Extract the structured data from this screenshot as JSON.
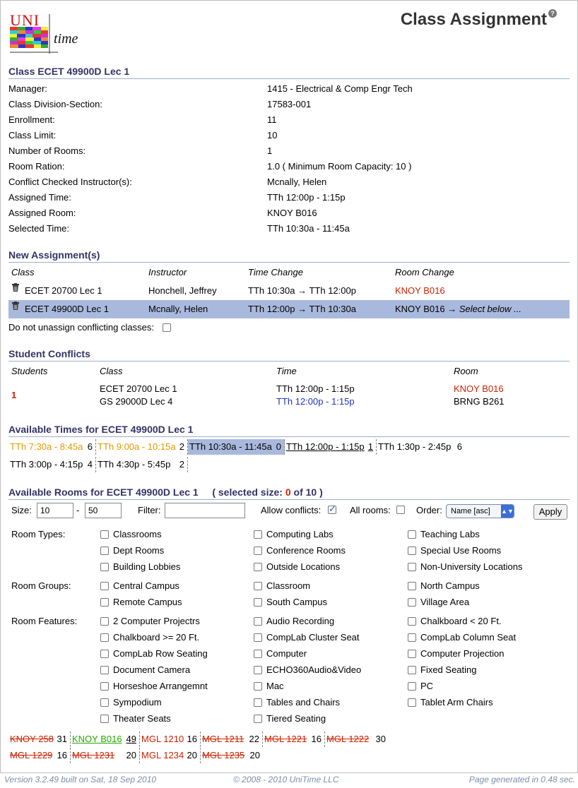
{
  "app": {
    "logo_text_1": "UNI",
    "logo_text_2": "time"
  },
  "page_title": "Class Assignment",
  "class_section": {
    "title": "Class ECET 49900D Lec 1",
    "fields": [
      {
        "label": "Manager:",
        "value": "1415 - Electrical & Comp Engr Tech"
      },
      {
        "label": "Class Division-Section:",
        "value": "17583-001"
      },
      {
        "label": "Enrollment:",
        "value": "11"
      },
      {
        "label": "Class Limit:",
        "value": "10"
      },
      {
        "label": "Number of Rooms:",
        "value": "1"
      },
      {
        "label": "Room Ration:",
        "value": "1.0 ( Minimum Room Capacity: 10 )"
      },
      {
        "label": "Conflict Checked Instructor(s):",
        "value": "Mcnally, Helen"
      },
      {
        "label": "Assigned Time:",
        "value": "TTh 12:00p - 1:15p"
      },
      {
        "label": "Assigned Room:",
        "value": "KNOY B016"
      },
      {
        "label": "Selected Time:",
        "value": "TTh 10:30a - 11:45a"
      }
    ]
  },
  "new_assignments": {
    "title": "New Assignment(s)",
    "headers": {
      "class": "Class",
      "instructor": "Instructor",
      "time": "Time Change",
      "room": "Room Change"
    },
    "rows": [
      {
        "class": "ECET 20700 Lec 1",
        "instructor": "Honchell, Jeffrey",
        "time": "TTh 10:30a → TTh 12:00p",
        "room": "KNOY B016",
        "room_extra": ""
      },
      {
        "class": "ECET 49900D Lec 1",
        "instructor": "Mcnally, Helen",
        "time": "TTh 12:00p → TTh 10:30a",
        "room": "KNOY B016 → ",
        "room_extra": "Select below ..."
      }
    ],
    "unassign_label": "Do not unassign conflicting classes:"
  },
  "student_conflicts": {
    "title": "Student Conflicts",
    "headers": {
      "students": "Students",
      "class": "Class",
      "time": "Time",
      "room": "Room"
    },
    "count": "1",
    "classes": [
      "ECET 20700 Lec 1",
      "GS 29000D Lec 4"
    ],
    "times": [
      "TTh 12:00p - 1:15p",
      "TTh 12:00p - 1:15p"
    ],
    "rooms": [
      "KNOY B016",
      "BRNG B261"
    ]
  },
  "available_times": {
    "title": "Available Times for ECET 49900D Lec 1",
    "slots": [
      {
        "time": "TTh 7:30a - 8:45a",
        "count": "6"
      },
      {
        "time": "TTh 9:00a - 10:15a",
        "count": "2"
      },
      {
        "time": "TTh 10:30a - 11:45a",
        "count": "0"
      },
      {
        "time": "TTh 12:00p - 1:15p",
        "count": "1"
      },
      {
        "time": "TTh 1:30p - 2:45p",
        "count": "6"
      },
      {
        "time": "TTh 3:00p - 4:15p",
        "count": "4"
      },
      {
        "time": "TTh 4:30p - 5:45p",
        "count": "2"
      }
    ]
  },
  "available_rooms": {
    "title": "Available Rooms for ECET 49900D Lec 1",
    "selected_prefix": "( selected size: ",
    "selected_value": "0",
    "selected_suffix": " of 10 )",
    "size_label": "Size:",
    "size_min": "10",
    "size_dash": "-",
    "size_max": "50",
    "filter_label": "Filter:",
    "filter_value": "",
    "allow_conflicts_label": "Allow conflicts:",
    "all_rooms_label": "All rooms:",
    "order_label": "Order:",
    "order_value": "Name [asc]",
    "apply_label": "Apply",
    "room_types_label": "Room Types:",
    "room_types": [
      "Classrooms",
      "Computing Labs",
      "Teaching Labs",
      "Dept Rooms",
      "Conference Rooms",
      "Special Use Rooms",
      "Building Lobbies",
      "Outside Locations",
      "Non-University Locations"
    ],
    "room_groups_label": "Room Groups:",
    "room_groups": [
      "Central Campus",
      "Classroom",
      "North Campus",
      "Remote Campus",
      "South Campus",
      "Village Area"
    ],
    "room_features_label": "Room Features:",
    "room_features": [
      "2 Computer Projectrs",
      "Audio Recording",
      "Chalkboard < 20 Ft.",
      "Chalkboard >= 20 Ft.",
      "CompLab Cluster Seat",
      "CompLab Column Seat",
      "CompLab Row Seating",
      "Computer",
      "Computer Projection",
      "Document Camera",
      "ECHO360Audio&Video",
      "Fixed Seating",
      "Horseshoe Arrangemnt",
      "Mac",
      "PC",
      "Sympodium",
      "Tables and Chairs",
      "Tablet Arm Chairs",
      "Theater Seats",
      "Tiered Seating"
    ],
    "rooms": [
      {
        "name": "KNOY 258",
        "size": "31"
      },
      {
        "name": "KNOY B016",
        "size": "49"
      },
      {
        "name": "MGL 1210",
        "size": "16"
      },
      {
        "name": "MGL 1211",
        "size": "22"
      },
      {
        "name": "MGL 1221",
        "size": "16"
      },
      {
        "name": "MGL 1222",
        "size": "30"
      },
      {
        "name": "MGL 1229",
        "size": "16"
      },
      {
        "name": "MGL 1231",
        "size": "20"
      },
      {
        "name": "MGL 1234",
        "size": "20"
      },
      {
        "name": "MGL 1235",
        "size": "20"
      }
    ]
  },
  "footer": {
    "version": "Version 3.2.49 built on Sat, 18 Sep 2010",
    "copyright": "© 2008 - 2010 UniTime LLC",
    "generated": "Page generated in 0.48 sec."
  }
}
